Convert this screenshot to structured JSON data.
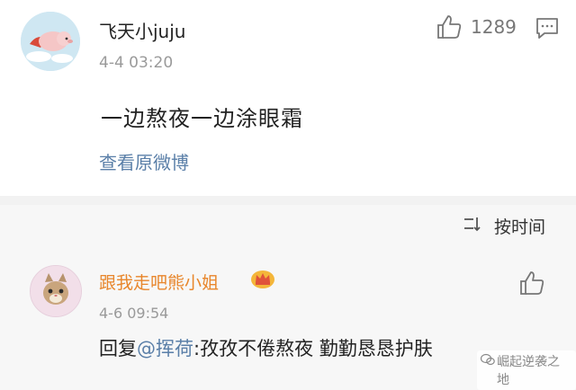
{
  "comment": {
    "username": "飞天小juju",
    "timestamp": "4-4 03:20",
    "text": "一边熬夜一边涂眼霜",
    "view_original": "查看原微博",
    "like_count": "1289",
    "avatar_icon": "flying-pig-avatar",
    "like_icon": "thumbs-up-icon",
    "comment_icon": "comment-bubble-icon"
  },
  "sort": {
    "label": "按时间",
    "icon": "sort-icon"
  },
  "reply": {
    "username": "跟我走吧熊小姐",
    "badge_icon": "crown-icon",
    "timestamp": "4-6 09:54",
    "prefix": "回复",
    "mention": "@挥荷",
    "text": ":孜孜不倦熬夜  勤勤恳恳护肤",
    "avatar_icon": "cat-avatar",
    "like_icon": "thumbs-up-icon"
  },
  "watermark": {
    "text": "崛起逆袭之地",
    "icon": "wechat-icon"
  },
  "colors": {
    "link": "#5a7fa8",
    "reply_username": "#e8862b",
    "muted": "#9a9a9a"
  }
}
